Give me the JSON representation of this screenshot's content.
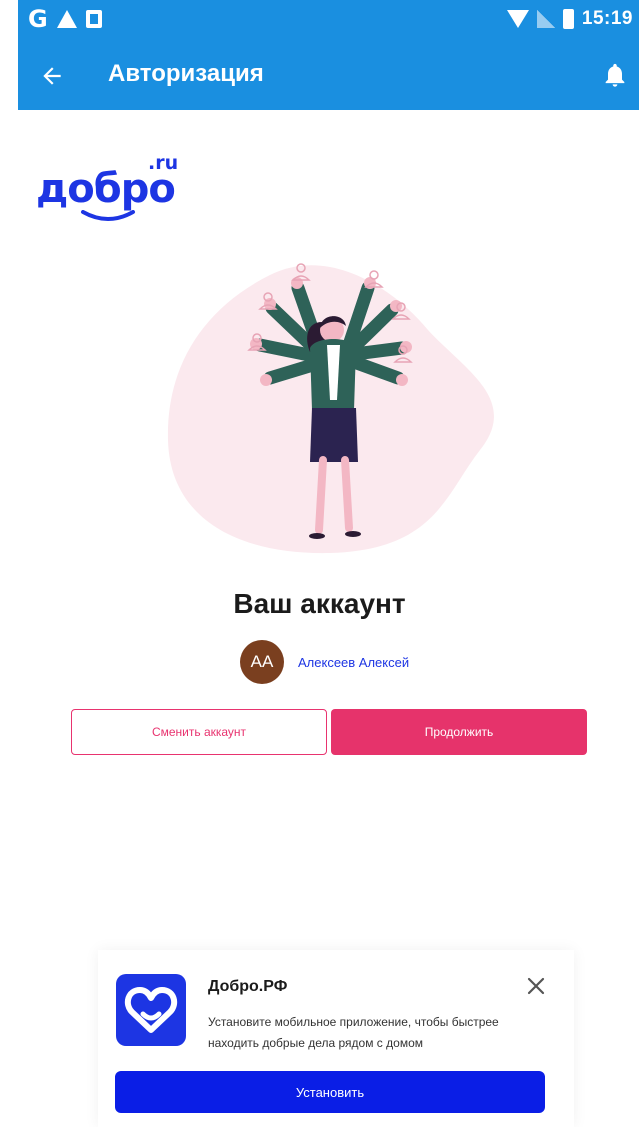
{
  "status_bar": {
    "left_icons": [
      "google-icon",
      "warning-icon",
      "notification-box-icon"
    ],
    "right_icons": [
      "wifi-icon",
      "signal-icon",
      "battery-icon"
    ],
    "time": "15:19"
  },
  "app_bar": {
    "title": "Авторизация",
    "back_icon": "arrow-left-icon",
    "action_icon": "bell-icon",
    "color": "#1a8fe0"
  },
  "logo": {
    "text": "добро",
    "suffix": ".ru",
    "color": "#1d35e3"
  },
  "account": {
    "heading": "Ваш аккаунт",
    "avatar_initials": "АА",
    "name": "Алексеев Алексей",
    "avatar_color": "#7a3f1f"
  },
  "buttons": {
    "switch_label": "Сменить аккаунт",
    "continue_label": "Продолжить",
    "accent": "#e6336b"
  },
  "banner": {
    "app_name": "Добро.РФ",
    "text": "Установите мобильное приложение, чтобы быстрее находить добрые дела рядом с домом",
    "install_label": "Установить",
    "close_icon": "close-icon",
    "app_icon": "heart-icon",
    "button_color": "#0a1ee6"
  }
}
